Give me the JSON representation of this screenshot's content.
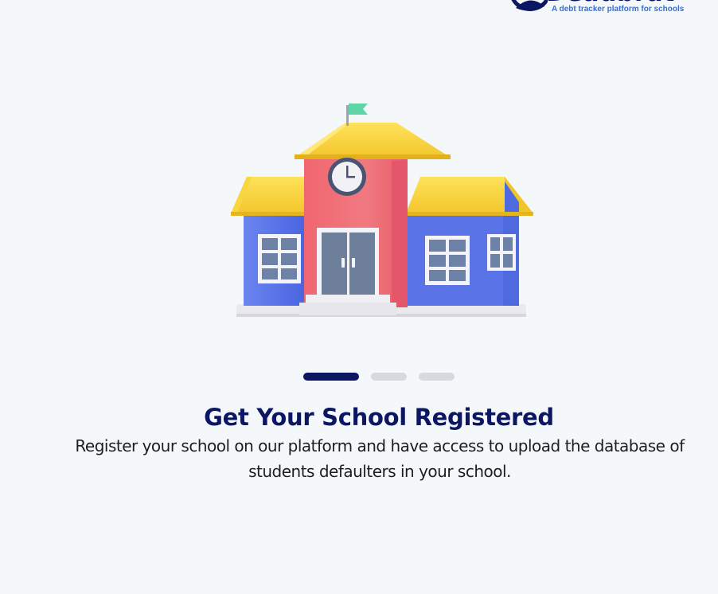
{
  "brand": {
    "name": "Deadbrat",
    "tagline": "A debt tracker platform for schools",
    "colors": {
      "navy": "#0c1763",
      "blue": "#2f6fe0"
    }
  },
  "illustration": {
    "icon": "school-building-icon"
  },
  "carousel": {
    "total_slides": 3,
    "active_index": 0,
    "slides": [
      {
        "title": "Get Your School Registered",
        "description": "Register your school on our platform and have access to upload the database of students defaulters in your school."
      }
    ]
  }
}
